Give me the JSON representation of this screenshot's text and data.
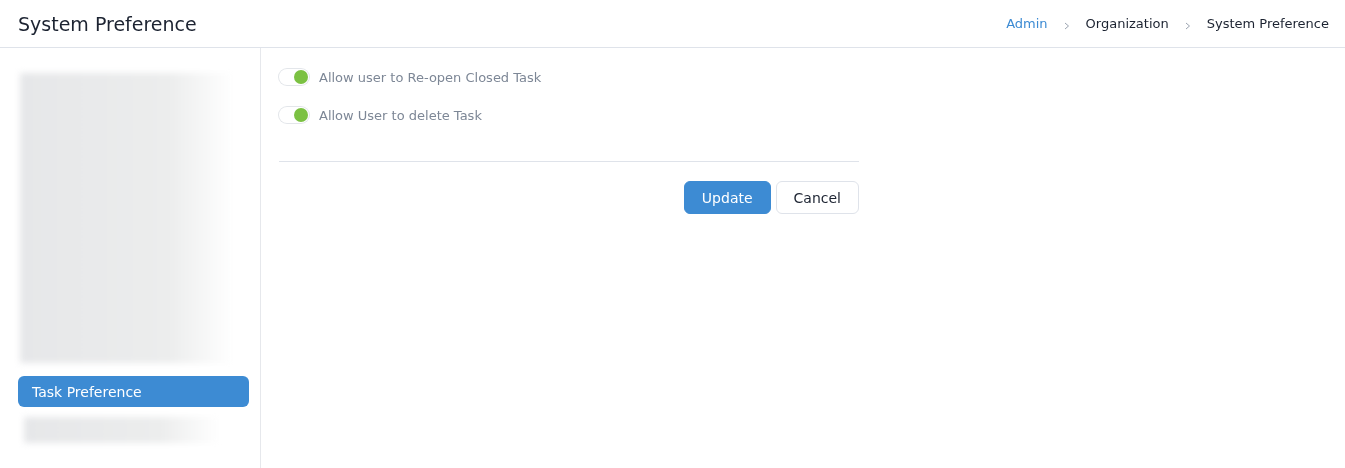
{
  "header": {
    "title": "System Preference",
    "breadcrumb": [
      {
        "label": "Admin",
        "kind": "link"
      },
      {
        "label": "Organization",
        "kind": "text"
      },
      {
        "label": "System Preference",
        "kind": "text"
      }
    ]
  },
  "sidebar": {
    "items": [
      {
        "label": "Task Preference",
        "selected": true
      }
    ]
  },
  "settings": [
    {
      "label": "Allow user to Re-open Closed Task",
      "on": true
    },
    {
      "label": "Allow User to delete Task",
      "on": true
    }
  ],
  "buttons": [
    {
      "label": "Update",
      "kind": "primary"
    },
    {
      "label": "Cancel",
      "kind": "secondary"
    }
  ]
}
